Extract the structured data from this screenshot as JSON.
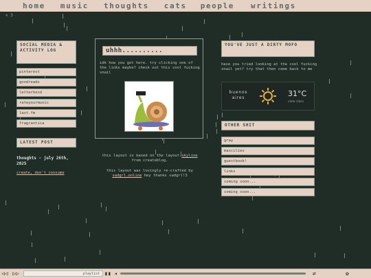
{
  "nav": {
    "items": [
      "home",
      "music",
      "thoughts",
      "cats",
      "people",
      "writings"
    ]
  },
  "marker": "< 3",
  "left": {
    "social_header": "social media & activity log",
    "social_links": [
      "pinterest",
      "goodreads",
      "letterboxd",
      "rateyourmusic",
      "last.fm",
      "fragrantica"
    ],
    "latest_header": "latest post",
    "latest_title": "thoughts - july 26th, 2025",
    "latest_link": "create, don't consume"
  },
  "center": {
    "title": "uhhh..........",
    "intro": "idk how you got here. try clicking one of the links maybe? check out this cool fucking snail",
    "credit_pre": "this layout is based on the layout ",
    "credit_link": "skyline",
    "credit_post": " from createblog.",
    "remake_pre": "this layout was lovingly re-crafted by ",
    "remake_link": "sadgrl.online",
    "remake_post": " hey thanks sadgrl!3"
  },
  "right": {
    "header": "you've just a dirty mofo",
    "text": "have you tried looking at the cool fucking snail yet? try that then come back to me",
    "weather": {
      "city": "buenos aires",
      "temp": "31°C",
      "condition": "cielo claro"
    },
    "other_header": "other shit",
    "other_links": [
      "gray",
      "mascilies",
      "guestbook!",
      "links",
      "coming soon...",
      "coming soon..."
    ]
  },
  "player": {
    "track": "playlist"
  }
}
